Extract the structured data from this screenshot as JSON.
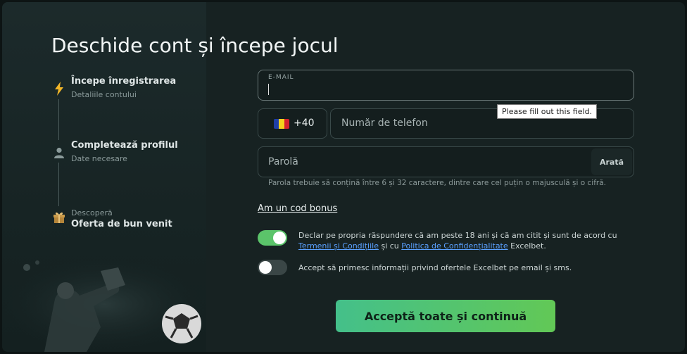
{
  "heading": "Deschide cont și începe jocul",
  "steps": [
    {
      "title": "Începe înregistrarea",
      "subtitle": "Detaliile contului",
      "icon": "lightning-icon"
    },
    {
      "title": "Completează profilul",
      "subtitle": "Date necesare",
      "icon": "user-icon"
    },
    {
      "label": "Descoperă",
      "title": "Oferta de bun venit",
      "icon": "gift-icon"
    }
  ],
  "form": {
    "email_label": "E-MAIL",
    "email_value": "",
    "country_code": "+40",
    "phone_placeholder": "Număr de telefon",
    "tooltip": "Please fill out this field.",
    "password_placeholder": "Parolă",
    "show_label": "Arată",
    "password_hint": "Parola trebuie să conțină între 6 și 32 caractere, dintre care cel puțin o majusculă și o cifră.",
    "bonus_link": "Am un cod bonus"
  },
  "consents": {
    "terms_prefix": "Declar pe propria răspundere că am peste 18 ani și că am citit și sunt de acord cu ",
    "terms_link": "Termenii și Condițiile",
    "terms_middle": " și cu ",
    "privacy_link": "Politica de Confidențialitate",
    "terms_suffix": " Excelbet.",
    "terms_on": true,
    "marketing_text": "Accept să primesc informații privind ofertele Excelbet pe email și sms.",
    "marketing_on": false
  },
  "cta_label": "Acceptă toate și continuă",
  "colors": {
    "accent": "#5bc46a",
    "toggle_on": "#5bc46a",
    "toggle_off": "#3a4646"
  }
}
